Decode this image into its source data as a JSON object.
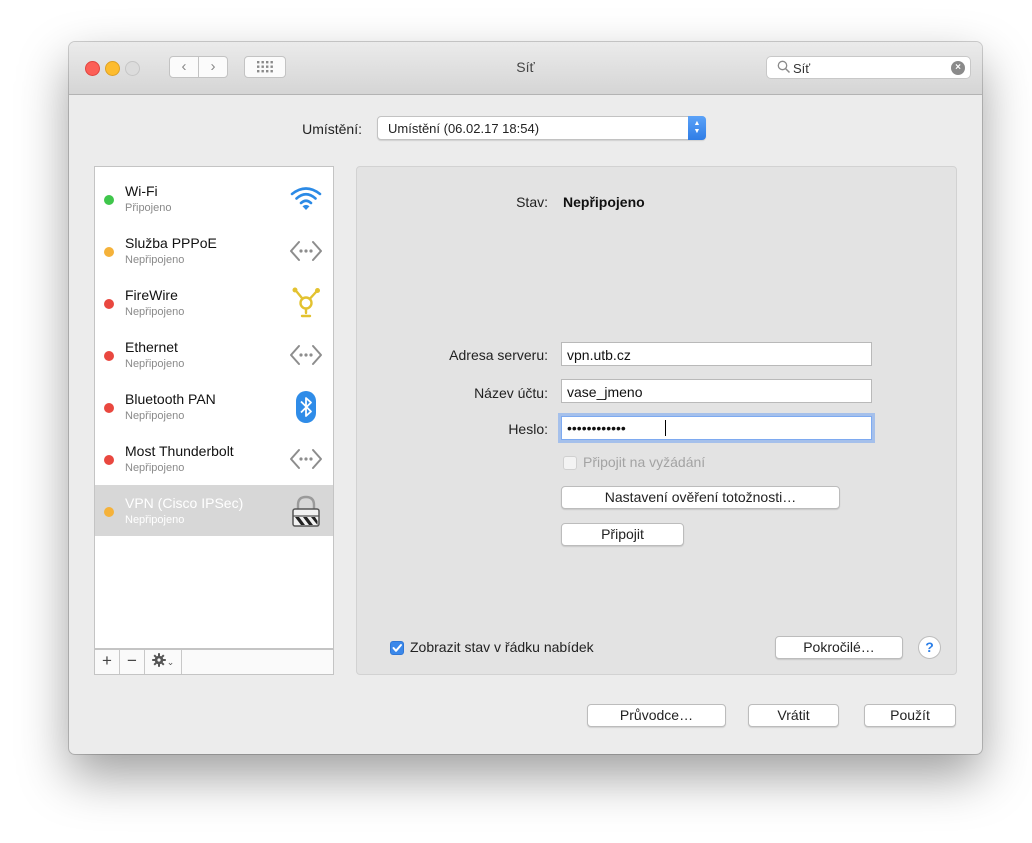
{
  "window": {
    "title": "Síť",
    "search_value": "Síť",
    "search_clear_icon": "clear-icon",
    "nav": {
      "back": "‹",
      "forward": "›"
    }
  },
  "location": {
    "label": "Umístění:",
    "selected": "Umístění (06.02.17 18:54)"
  },
  "services": [
    {
      "name": "Wi-Fi",
      "status": "Připojeno",
      "dot_color": "#3fc64b",
      "icon": "wifi-icon"
    },
    {
      "name": "Služba PPPoE",
      "status": "Nepřipojeno",
      "dot_color": "#f5b23a",
      "icon": "network-arrows-icon"
    },
    {
      "name": "FireWire",
      "status": "Nepřipojeno",
      "dot_color": "#e9473f",
      "icon": "firewire-icon"
    },
    {
      "name": "Ethernet",
      "status": "Nepřipojeno",
      "dot_color": "#e9473f",
      "icon": "network-arrows-icon"
    },
    {
      "name": "Bluetooth PAN",
      "status": "Nepřipojeno",
      "dot_color": "#e9473f",
      "icon": "bluetooth-icon"
    },
    {
      "name": "Most Thunderbolt",
      "status": "Nepřipojeno",
      "dot_color": "#e9473f",
      "icon": "network-arrows-icon"
    },
    {
      "name": "VPN (Cisco IPSec)",
      "status": "Nepřipojeno",
      "dot_color": "#f5b23a",
      "icon": "vpn-lock-icon",
      "selected": true
    }
  ],
  "sidebar_buttons": {
    "add": "+",
    "remove": "−"
  },
  "detail": {
    "status_label": "Stav:",
    "status_value": "Nepřipojeno",
    "server_label": "Adresa serveru:",
    "server_value": "vpn.utb.cz",
    "account_label": "Název účtu:",
    "account_value": "vase_jmeno",
    "password_label": "Heslo:",
    "password_value": "••••••••••••",
    "on_demand_label": "Připojit na vyžádání",
    "on_demand_checked": false,
    "auth_button": "Nastavení ověření totožnosti…",
    "connect_button": "Připojit",
    "show_status_label": "Zobrazit stav v řádku nabídek",
    "show_status_checked": true,
    "advanced_button": "Pokročilé…",
    "help_label": "?"
  },
  "footer": {
    "assistant": "Průvodce…",
    "revert": "Vrátit",
    "apply": "Použít"
  },
  "colors": {
    "accent": "#2f7de6",
    "window_bg": "#ececec",
    "panel_bg": "#e3e3e3",
    "selection": "#d7d7d7"
  }
}
